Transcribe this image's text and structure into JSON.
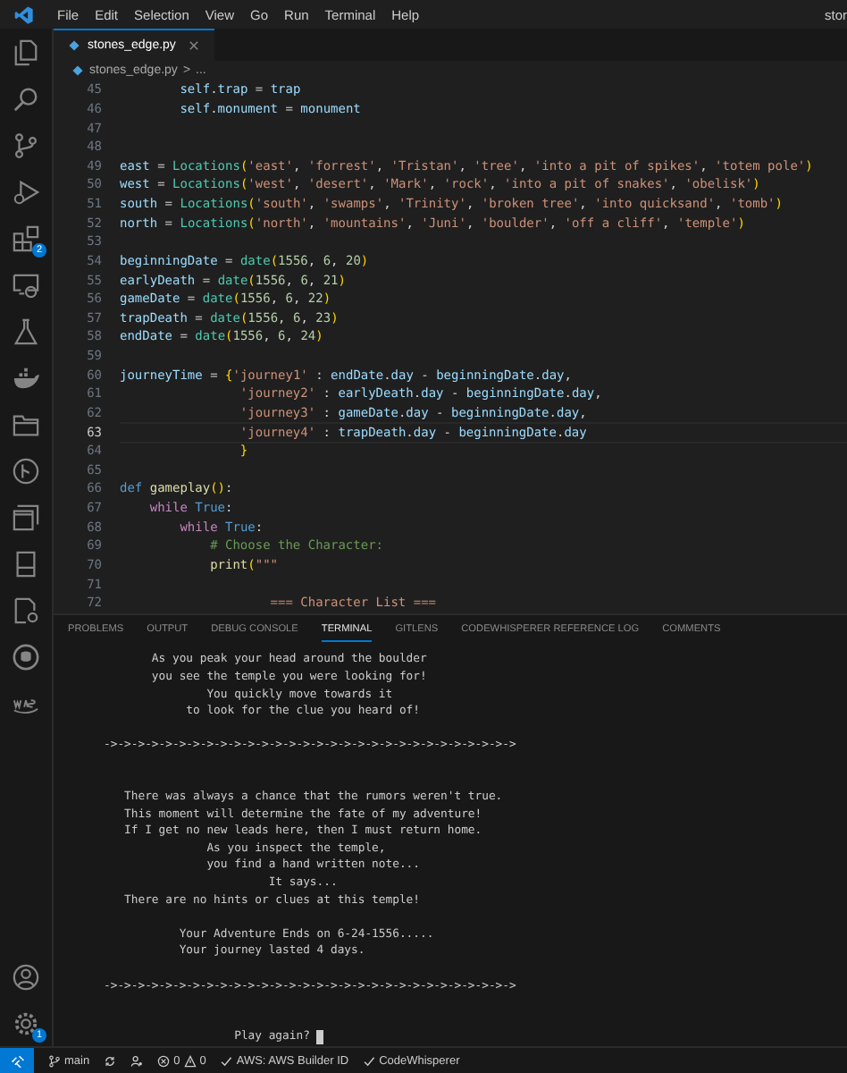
{
  "menu": {
    "items": [
      "File",
      "Edit",
      "Selection",
      "View",
      "Go",
      "Run",
      "Terminal",
      "Help"
    ],
    "title": "stor"
  },
  "activity_bar": {
    "extensions_badge": "2",
    "settings_badge": "1"
  },
  "editor": {
    "tab": {
      "label": "stones_edge.py",
      "selected": true
    },
    "breadcrumb": [
      "stones_edge.py",
      ">",
      "..."
    ],
    "lines": [
      {
        "number": "45",
        "current": false,
        "tokens": [
          {
            "text": "        self",
            "kind": "var"
          },
          {
            "text": ".",
            "kind": "punc"
          },
          {
            "text": "trap",
            "kind": "var"
          },
          {
            "text": " = ",
            "kind": "punc"
          },
          {
            "text": "trap",
            "kind": "var"
          }
        ]
      },
      {
        "number": "46",
        "current": false,
        "tokens": [
          {
            "text": "        self",
            "kind": "var"
          },
          {
            "text": ".",
            "kind": "punc"
          },
          {
            "text": "monument",
            "kind": "var"
          },
          {
            "text": " = ",
            "kind": "punc"
          },
          {
            "text": "monument",
            "kind": "var"
          }
        ]
      },
      {
        "number": "47",
        "current": false
      },
      {
        "number": "48",
        "current": false
      },
      {
        "number": "49",
        "current": false,
        "tokens": [
          {
            "text": "east",
            "kind": "var"
          },
          {
            "text": " = ",
            "kind": "punc"
          },
          {
            "text": "Locations",
            "kind": "cls"
          },
          {
            "text": "(",
            "kind": "bracket"
          },
          {
            "text": "'east'",
            "kind": "str"
          },
          {
            "text": ", ",
            "kind": "punc"
          },
          {
            "text": "'forrest'",
            "kind": "str"
          },
          {
            "text": ", ",
            "kind": "punc"
          },
          {
            "text": "'Tristan'",
            "kind": "str"
          },
          {
            "text": ", ",
            "kind": "punc"
          },
          {
            "text": "'tree'",
            "kind": "str"
          },
          {
            "text": ", ",
            "kind": "punc"
          },
          {
            "text": "'into a pit of spikes'",
            "kind": "str"
          },
          {
            "text": ", ",
            "kind": "punc"
          },
          {
            "text": "'totem pole'",
            "kind": "str"
          },
          {
            "text": ")",
            "kind": "bracket"
          }
        ]
      },
      {
        "number": "50",
        "current": false,
        "tokens": [
          {
            "text": "west",
            "kind": "var"
          },
          {
            "text": " = ",
            "kind": "punc"
          },
          {
            "text": "Locations",
            "kind": "cls"
          },
          {
            "text": "(",
            "kind": "bracket"
          },
          {
            "text": "'west'",
            "kind": "str"
          },
          {
            "text": ", ",
            "kind": "punc"
          },
          {
            "text": "'desert'",
            "kind": "str"
          },
          {
            "text": ", ",
            "kind": "punc"
          },
          {
            "text": "'Mark'",
            "kind": "str"
          },
          {
            "text": ", ",
            "kind": "punc"
          },
          {
            "text": "'rock'",
            "kind": "str"
          },
          {
            "text": ", ",
            "kind": "punc"
          },
          {
            "text": "'into a pit of snakes'",
            "kind": "str"
          },
          {
            "text": ", ",
            "kind": "punc"
          },
          {
            "text": "'obelisk'",
            "kind": "str"
          },
          {
            "text": ")",
            "kind": "bracket"
          }
        ]
      },
      {
        "number": "51",
        "current": false,
        "tokens": [
          {
            "text": "south",
            "kind": "var"
          },
          {
            "text": " = ",
            "kind": "punc"
          },
          {
            "text": "Locations",
            "kind": "cls"
          },
          {
            "text": "(",
            "kind": "bracket"
          },
          {
            "text": "'south'",
            "kind": "str"
          },
          {
            "text": ", ",
            "kind": "punc"
          },
          {
            "text": "'swamps'",
            "kind": "str"
          },
          {
            "text": ", ",
            "kind": "punc"
          },
          {
            "text": "'Trinity'",
            "kind": "str"
          },
          {
            "text": ", ",
            "kind": "punc"
          },
          {
            "text": "'broken tree'",
            "kind": "str"
          },
          {
            "text": ", ",
            "kind": "punc"
          },
          {
            "text": "'into quicksand'",
            "kind": "str"
          },
          {
            "text": ", ",
            "kind": "punc"
          },
          {
            "text": "'tomb'",
            "kind": "str"
          },
          {
            "text": ")",
            "kind": "bracket"
          }
        ]
      },
      {
        "number": "52",
        "current": false,
        "tokens": [
          {
            "text": "north",
            "kind": "var"
          },
          {
            "text": " = ",
            "kind": "punc"
          },
          {
            "text": "Locations",
            "kind": "cls"
          },
          {
            "text": "(",
            "kind": "bracket"
          },
          {
            "text": "'north'",
            "kind": "str"
          },
          {
            "text": ", ",
            "kind": "punc"
          },
          {
            "text": "'mountains'",
            "kind": "str"
          },
          {
            "text": ", ",
            "kind": "punc"
          },
          {
            "text": "'Juni'",
            "kind": "str"
          },
          {
            "text": ", ",
            "kind": "punc"
          },
          {
            "text": "'boulder'",
            "kind": "str"
          },
          {
            "text": ", ",
            "kind": "punc"
          },
          {
            "text": "'off a cliff'",
            "kind": "str"
          },
          {
            "text": ", ",
            "kind": "punc"
          },
          {
            "text": "'temple'",
            "kind": "str"
          },
          {
            "text": ")",
            "kind": "bracket"
          }
        ]
      },
      {
        "number": "53",
        "current": false
      },
      {
        "number": "54",
        "current": false,
        "tokens": [
          {
            "text": "beginningDate",
            "kind": "var"
          },
          {
            "text": " = ",
            "kind": "punc"
          },
          {
            "text": "date",
            "kind": "cls"
          },
          {
            "text": "(",
            "kind": "bracket"
          },
          {
            "text": "1556",
            "kind": "num"
          },
          {
            "text": ", ",
            "kind": "punc"
          },
          {
            "text": "6",
            "kind": "num"
          },
          {
            "text": ", ",
            "kind": "punc"
          },
          {
            "text": "20",
            "kind": "num"
          },
          {
            "text": ")",
            "kind": "bracket"
          }
        ]
      },
      {
        "number": "55",
        "current": false,
        "tokens": [
          {
            "text": "earlyDeath",
            "kind": "var"
          },
          {
            "text": " = ",
            "kind": "punc"
          },
          {
            "text": "date",
            "kind": "cls"
          },
          {
            "text": "(",
            "kind": "bracket"
          },
          {
            "text": "1556",
            "kind": "num"
          },
          {
            "text": ", ",
            "kind": "punc"
          },
          {
            "text": "6",
            "kind": "num"
          },
          {
            "text": ", ",
            "kind": "punc"
          },
          {
            "text": "21",
            "kind": "num"
          },
          {
            "text": ")",
            "kind": "bracket"
          }
        ]
      },
      {
        "number": "56",
        "current": false,
        "tokens": [
          {
            "text": "gameDate",
            "kind": "var"
          },
          {
            "text": " = ",
            "kind": "punc"
          },
          {
            "text": "date",
            "kind": "cls"
          },
          {
            "text": "(",
            "kind": "bracket"
          },
          {
            "text": "1556",
            "kind": "num"
          },
          {
            "text": ", ",
            "kind": "punc"
          },
          {
            "text": "6",
            "kind": "num"
          },
          {
            "text": ", ",
            "kind": "punc"
          },
          {
            "text": "22",
            "kind": "num"
          },
          {
            "text": ")",
            "kind": "bracket"
          }
        ]
      },
      {
        "number": "57",
        "current": false,
        "tokens": [
          {
            "text": "trapDeath",
            "kind": "var"
          },
          {
            "text": " = ",
            "kind": "punc"
          },
          {
            "text": "date",
            "kind": "cls"
          },
          {
            "text": "(",
            "kind": "bracket"
          },
          {
            "text": "1556",
            "kind": "num"
          },
          {
            "text": ", ",
            "kind": "punc"
          },
          {
            "text": "6",
            "kind": "num"
          },
          {
            "text": ", ",
            "kind": "punc"
          },
          {
            "text": "23",
            "kind": "num"
          },
          {
            "text": ")",
            "kind": "bracket"
          }
        ]
      },
      {
        "number": "58",
        "current": false,
        "tokens": [
          {
            "text": "endDate",
            "kind": "var"
          },
          {
            "text": " = ",
            "kind": "punc"
          },
          {
            "text": "date",
            "kind": "cls"
          },
          {
            "text": "(",
            "kind": "bracket"
          },
          {
            "text": "1556",
            "kind": "num"
          },
          {
            "text": ", ",
            "kind": "punc"
          },
          {
            "text": "6",
            "kind": "num"
          },
          {
            "text": ", ",
            "kind": "punc"
          },
          {
            "text": "24",
            "kind": "num"
          },
          {
            "text": ")",
            "kind": "bracket"
          }
        ]
      },
      {
        "number": "59",
        "current": false
      },
      {
        "number": "60",
        "current": false,
        "tokens": [
          {
            "text": "journeyTime",
            "kind": "var"
          },
          {
            "text": " = ",
            "kind": "punc"
          },
          {
            "text": "{",
            "kind": "bracket"
          },
          {
            "text": "'journey1'",
            "kind": "str"
          },
          {
            "text": " : ",
            "kind": "punc"
          },
          {
            "text": "endDate",
            "kind": "var"
          },
          {
            "text": ".",
            "kind": "punc"
          },
          {
            "text": "day",
            "kind": "var"
          },
          {
            "text": " - ",
            "kind": "punc"
          },
          {
            "text": "beginningDate",
            "kind": "var"
          },
          {
            "text": ".",
            "kind": "punc"
          },
          {
            "text": "day",
            "kind": "var"
          },
          {
            "text": ",",
            "kind": "punc"
          }
        ]
      },
      {
        "number": "61",
        "current": false,
        "tokens": [
          {
            "text": "                'journey2'",
            "kind": "str"
          },
          {
            "text": " : ",
            "kind": "punc"
          },
          {
            "text": "earlyDeath",
            "kind": "var"
          },
          {
            "text": ".",
            "kind": "punc"
          },
          {
            "text": "day",
            "kind": "var"
          },
          {
            "text": " - ",
            "kind": "punc"
          },
          {
            "text": "beginningDate",
            "kind": "var"
          },
          {
            "text": ".",
            "kind": "punc"
          },
          {
            "text": "day",
            "kind": "var"
          },
          {
            "text": ",",
            "kind": "punc"
          }
        ]
      },
      {
        "number": "62",
        "current": false,
        "tokens": [
          {
            "text": "                'journey3'",
            "kind": "str"
          },
          {
            "text": " : ",
            "kind": "punc"
          },
          {
            "text": "gameDate",
            "kind": "var"
          },
          {
            "text": ".",
            "kind": "punc"
          },
          {
            "text": "day",
            "kind": "var"
          },
          {
            "text": " - ",
            "kind": "punc"
          },
          {
            "text": "beginningDate",
            "kind": "var"
          },
          {
            "text": ".",
            "kind": "punc"
          },
          {
            "text": "day",
            "kind": "var"
          },
          {
            "text": ",",
            "kind": "punc"
          }
        ]
      },
      {
        "number": "63",
        "current": true,
        "tokens": [
          {
            "text": "                'journey4'",
            "kind": "str"
          },
          {
            "text": " : ",
            "kind": "punc"
          },
          {
            "text": "trapDeath",
            "kind": "var"
          },
          {
            "text": ".",
            "kind": "punc"
          },
          {
            "text": "day",
            "kind": "var"
          },
          {
            "text": " - ",
            "kind": "punc"
          },
          {
            "text": "beginningDate",
            "kind": "var"
          },
          {
            "text": ".",
            "kind": "punc"
          },
          {
            "text": "day",
            "kind": "var"
          }
        ]
      },
      {
        "number": "64",
        "current": false,
        "tokens": [
          {
            "text": "                }",
            "kind": "bracket"
          }
        ]
      },
      {
        "number": "65",
        "current": false
      },
      {
        "number": "66",
        "current": false,
        "tokens": [
          {
            "text": "def",
            "kind": "kw"
          },
          {
            "text": " gameplay",
            "kind": "fn"
          },
          {
            "text": "()",
            "kind": "bracket"
          },
          {
            "text": ":",
            "kind": "punc"
          }
        ]
      },
      {
        "number": "67",
        "current": false,
        "tokens": [
          {
            "text": "    while",
            "kind": "ctrl"
          },
          {
            "text": " True",
            "kind": "kw"
          },
          {
            "text": ":",
            "kind": "punc"
          }
        ]
      },
      {
        "number": "68",
        "current": false,
        "tokens": [
          {
            "text": "        while",
            "kind": "ctrl"
          },
          {
            "text": " True",
            "kind": "kw"
          },
          {
            "text": ":",
            "kind": "punc"
          }
        ]
      },
      {
        "number": "69",
        "current": false,
        "tokens": [
          {
            "text": "            # Choose the Character:",
            "kind": "comment"
          }
        ]
      },
      {
        "number": "70",
        "current": false,
        "tokens": [
          {
            "text": "            print",
            "kind": "fn"
          },
          {
            "text": "(",
            "kind": "bracket"
          },
          {
            "text": "\"\"\"",
            "kind": "str"
          }
        ]
      },
      {
        "number": "71",
        "current": false
      },
      {
        "number": "72",
        "current": false,
        "tokens": [
          {
            "text": "                    === Character List ===",
            "kind": "str"
          }
        ]
      }
    ]
  },
  "panel": {
    "tabs": [
      {
        "label": "PROBLEMS",
        "selected": false
      },
      {
        "label": "OUTPUT",
        "selected": false
      },
      {
        "label": "DEBUG CONSOLE",
        "selected": false
      },
      {
        "label": "TERMINAL",
        "selected": true
      },
      {
        "label": "GITLENS",
        "selected": false
      },
      {
        "label": "CODEWHISPERER REFERENCE LOG",
        "selected": false
      },
      {
        "label": "COMMENTS",
        "selected": false
      }
    ],
    "terminal": [
      {
        "kind": "text",
        "lines": [
          "       As you peak your head around the boulder",
          "       you see the temple you were looking for!",
          "               You quickly move towards it",
          "            to look for the clue you heard of!"
        ]
      },
      {
        "kind": "rule",
        "lines": [
          "->->->->->->->->->->->->->->->->->->->->->->->->->->->->->->"
        ]
      },
      {
        "kind": "text",
        "lines": [
          "   There was always a chance that the rumors weren't true.",
          "   This moment will determine the fate of my adventure!",
          "   If I get no new leads here, then I must return home.",
          "               As you inspect the temple,",
          "               you find a hand written note...",
          "                        It says...",
          "   There are no hints or clues at this temple!"
        ]
      },
      {
        "kind": "text",
        "lines": [
          "           Your Adventure Ends on 6-24-1556.....",
          "           Your journey lasted 4 days."
        ]
      },
      {
        "kind": "rule",
        "lines": [
          "->->->->->->->->->->->->->->->->->->->->->->->->->->->->->->"
        ]
      },
      {
        "kind": "prompt",
        "lines": [
          "                   Play again?"
        ]
      }
    ]
  },
  "status_bar": {
    "branch": "main",
    "errors": "0",
    "warnings": "0",
    "items": [
      "AWS: AWS Builder ID",
      "CodeWhisperer"
    ]
  }
}
